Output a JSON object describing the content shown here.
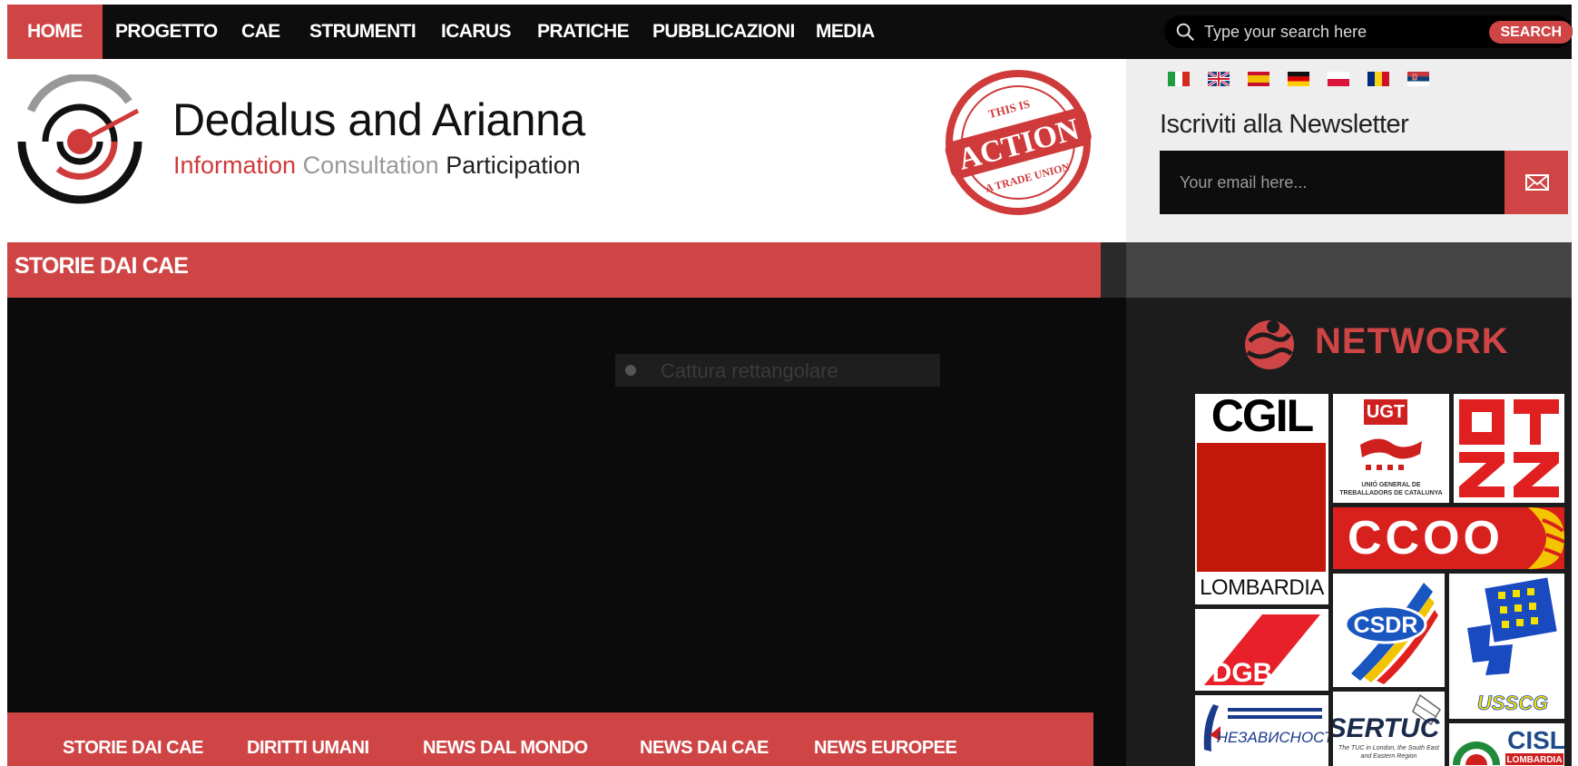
{
  "nav": {
    "items": [
      "HOME",
      "PROGETTO",
      "CAE",
      "STRUMENTI",
      "ICARUS",
      "PRATICHE",
      "PUBBLICAZIONI",
      "MEDIA"
    ],
    "active": "HOME",
    "search_placeholder": "Type your search here",
    "search_button": "SEARCH"
  },
  "header": {
    "site_title": "Dedalus and Arianna",
    "tagline_1": "Information",
    "tagline_2": "Consultation",
    "tagline_3": "Participation",
    "stamp_top": "THIS IS",
    "stamp_middle": "ACTION",
    "stamp_bottom": "A TRADE UNION"
  },
  "newsletter": {
    "title": "Iscriviti alla Newsletter",
    "email_placeholder": "Your email here..."
  },
  "flags": [
    "italy",
    "uk",
    "spain",
    "germany",
    "poland",
    "romania",
    "serbia"
  ],
  "section": {
    "title": "STORIE DAI CAE"
  },
  "overlay": {
    "capture_label": "Cattura rettangolare"
  },
  "bottom_tabs": [
    "STORIE DAI CAE",
    "DIRITTI UMANI",
    "NEWS DAL MONDO",
    "NEWS DAI CAE",
    "NEWS EUROPEE"
  ],
  "network": {
    "title": "NETWORK",
    "logos": {
      "cgil": "CGIL",
      "lombardia": "LOMBARDIA",
      "ugt": "UGT",
      "ugt_sub": "UNIÓ GENERAL DE TREBALLADORS DE CATALUNYA",
      "ccoo": "CCOO",
      "csdr": "CSDR",
      "dgb": "DGB",
      "usscg": "USSCG",
      "nezavisnost": "НЕЗАВИСНОСТ",
      "sertuc": "SERTUC",
      "sertuc_sub": "The TUC in London, the South East and Eastern Region",
      "cisl": "CISL",
      "cisl_sub": "LOMBARDIA"
    }
  },
  "colors": {
    "brand_red": "#cf4545",
    "nav_bg": "#0d0d0d",
    "sidebar_dark": "#1c1c1c"
  }
}
